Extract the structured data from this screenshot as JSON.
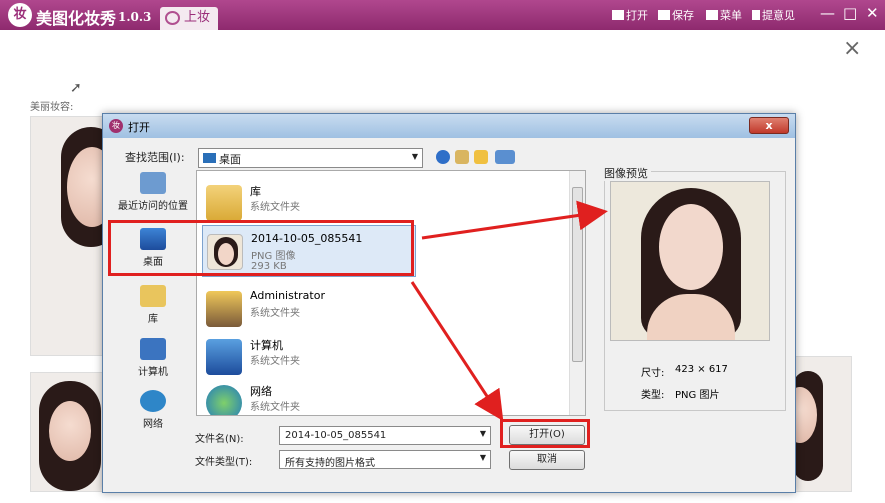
{
  "app": {
    "logo_text": "妆",
    "title": "美图化妆秀",
    "version": "1.0.3",
    "tab_label": "上妆",
    "toolbar": {
      "open": "打开",
      "save": "保存",
      "menu": "菜单",
      "feedback": "提意见"
    },
    "controls": {
      "minimize": "—",
      "maximize": "□",
      "close": "✕"
    },
    "panel_close": "×",
    "beauty_label": "美丽妆容:"
  },
  "dialog": {
    "title": "打开",
    "close_glyph": "x",
    "look_in_label": "查找范围(I):",
    "look_in_value": "桌面",
    "places": [
      {
        "label": "最近访问的位置",
        "icon": "recent-icon"
      },
      {
        "label": "桌面",
        "icon": "desktop-icon"
      },
      {
        "label": "库",
        "icon": "library-icon"
      },
      {
        "label": "计算机",
        "icon": "computer-icon"
      },
      {
        "label": "网络",
        "icon": "network-icon"
      }
    ],
    "files": [
      {
        "name": "库",
        "type": "系统文件夹",
        "size": ""
      },
      {
        "name": "2014-10-05_085541",
        "type": "PNG 图像",
        "size": "293 KB"
      },
      {
        "name": "Administrator",
        "type": "系统文件夹",
        "size": ""
      },
      {
        "name": "计算机",
        "type": "系统文件夹",
        "size": ""
      },
      {
        "name": "网络",
        "type": "系统文件夹",
        "size": ""
      }
    ],
    "preview_label": "图像预览",
    "size_label": "尺寸:",
    "size_value": "423 × 617",
    "type_label": "类型:",
    "type_value": "PNG 图片",
    "filename_label": "文件名(N):",
    "filename_value": "2014-10-05_085541",
    "filetype_label": "文件类型(T):",
    "filetype_value": "所有支持的图片格式",
    "open_button": "打开(O)",
    "cancel_button": "取消"
  },
  "colors": {
    "titlebar": "#9b3479",
    "annotation_red": "#e0201f",
    "dialog_title": "#b3cfea"
  }
}
